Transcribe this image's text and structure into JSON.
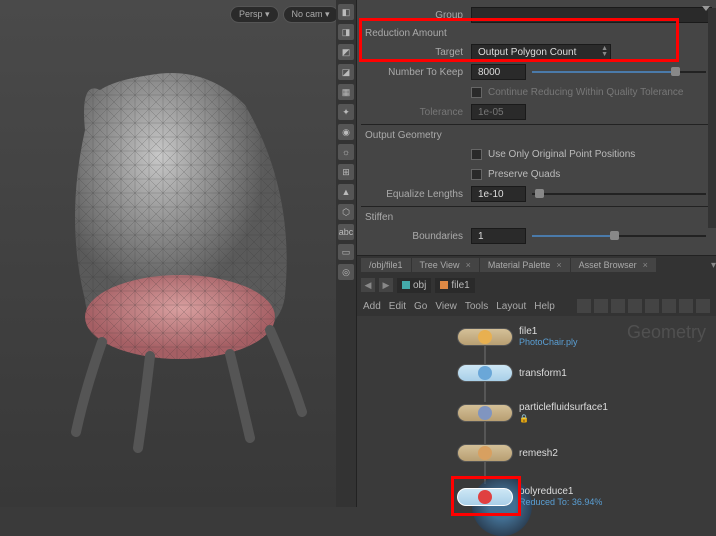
{
  "viewport": {
    "persp": "Persp ▾",
    "nocam": "No cam ▾"
  },
  "params": {
    "group_label": "Group",
    "section": "Reduction Amount",
    "target_label": "Target",
    "target_value": "Output Polygon Count",
    "number_label": "Number To Keep",
    "number_value": "8000",
    "chk_quality": "Continue Reducing Within Quality Tolerance",
    "tolerance_label": "Tolerance",
    "tolerance_value": "1e-05",
    "outgeo": "Output Geometry",
    "chk_origpts": "Use Only Original Point Positions",
    "chk_presquads": "Preserve Quads",
    "eqlen_label": "Equalize Lengths",
    "eqlen_value": "1e-10",
    "stiffen": "Stiffen",
    "boundaries_label": "Boundaries",
    "boundaries_value": "1"
  },
  "tabs": {
    "path_hint": "/obj/file1",
    "tab1": "Tree View",
    "tab2": "Material Palette",
    "tab3": "Asset Browser",
    "crumb1": "obj",
    "crumb2": "file1"
  },
  "menu": {
    "add": "Add",
    "edit": "Edit",
    "go": "Go",
    "view": "View",
    "tools": "Tools",
    "layout": "Layout",
    "help": "Help"
  },
  "network": {
    "watermark": "Geometry",
    "n1": "file1",
    "n1_sub": "PhotoChair.ply",
    "n2": "transform1",
    "n3": "particlefluidsurface1",
    "n4": "remesh2",
    "n5": "polyreduce1",
    "n5_sub": "Reduced To: 36.94%"
  }
}
